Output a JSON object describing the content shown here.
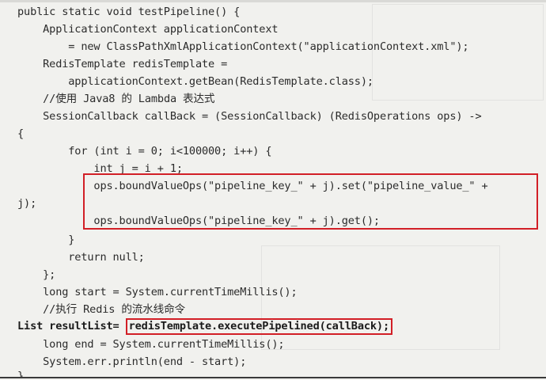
{
  "code": {
    "lines": [
      "public static void testPipeline() {",
      "    ApplicationContext applicationContext",
      "        = new ClassPathXmlApplicationContext(\"applicationContext.xml\");",
      "    RedisTemplate redisTemplate =",
      "        applicationContext.getBean(RedisTemplate.class);",
      "    //使用 Java8 的 Lambda 表达式",
      "    SessionCallback callBack = (SessionCallback) (RedisOperations ops) ->",
      "{",
      "        for (int i = 0; i<100000; i++) {",
      "            int j = i + 1;",
      "            ops.boundValueOps(\"pipeline_key_\" + j).set(\"pipeline_value_\" +",
      "j);",
      "            ops.boundValueOps(\"pipeline_key_\" + j).get();",
      "        }",
      "        return null;",
      "    };",
      "    long start = System.currentTimeMillis();",
      "    //执行 Redis 的流水线命令",
      "    long end = System.currentTimeMillis();",
      "    System.err.println(end - start);",
      "}"
    ],
    "result_line_prefix": "List resultList= ",
    "result_line_call": "redisTemplate.executePipelined(callBack);"
  },
  "highlight_color": "#d21f26"
}
